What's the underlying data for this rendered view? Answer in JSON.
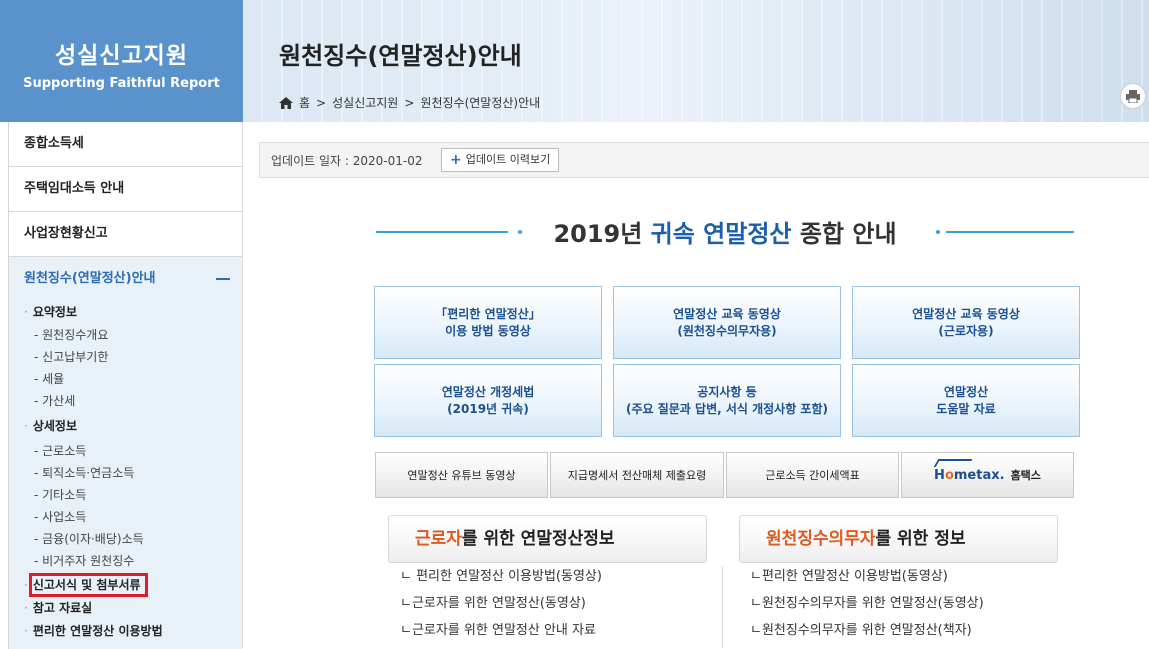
{
  "logo": {
    "title": "성실신고지원",
    "subtitle": "Supporting Faithful Report"
  },
  "header": {
    "page_title": "원천징수(연말정산)안내",
    "breadcrumb": [
      "홈",
      "성실신고지원",
      "원천징수(연말정산)안내"
    ],
    "separator": ">"
  },
  "sidebar": {
    "items": [
      "종합소득세",
      "주택임대소득 안내",
      "사업장현황신고"
    ],
    "active": {
      "label": "원천징수(연말정산)안내",
      "groups": [
        {
          "label": "요약정보",
          "children": [
            "- 원천징수개요",
            "- 신고납부기한",
            "- 세율",
            "- 가산세"
          ]
        },
        {
          "label": "상세정보",
          "children": [
            "- 근로소득",
            "- 퇴직소득·연금소득",
            "- 기타소득",
            "- 사업소득",
            "- 금융(이자·배당)소득",
            "- 비거주자 원천징수"
          ]
        },
        {
          "label": "신고서식 및 첨부서류",
          "children": []
        },
        {
          "label": "참고 자료실",
          "children": []
        },
        {
          "label": "편리한 연말정산 이용방법",
          "children": []
        }
      ]
    }
  },
  "update": {
    "label": "업데이트 일자 : 2020-01-02",
    "history_button": "업데이트 이력보기"
  },
  "main_title": {
    "prefix": "2019년 ",
    "accent": "귀속 연말정산",
    "suffix": " 종합 안내"
  },
  "big_buttons": [
    [
      "「편리한 연말정산」",
      "이용 방법 동영상"
    ],
    [
      "연말정산 교육 동영상",
      "(원천징수의무자용)"
    ],
    [
      "연말정산 교육 동영상",
      "(근로자용)"
    ],
    [
      "연말정산 개정세법",
      "(2019년 귀속)"
    ],
    [
      "공지사항 등",
      "(주요 질문과 답변, 서식 개정사항 포함)"
    ],
    [
      "연말정산",
      "도움말 자료"
    ]
  ],
  "gray_buttons": [
    "연말정산 유튜브 동영상",
    "지급명세서 전산매체 제출요령",
    "근로소득 간이세액표",
    "홈택스"
  ],
  "hometax_logo": {
    "left": "H",
    "o": "o",
    "right": "metax."
  },
  "worker_box": {
    "title_accent": "근로자",
    "title_rest": "를 위한 연말정산정보",
    "links": [
      "ㄴ 편리한 연말정산 이용방법(동영상)",
      "ㄴ근로자를 위한 연말정산(동영상)",
      "ㄴ근로자를 위한 연말정산 안내 자료"
    ]
  },
  "withholder_box": {
    "title_accent": "원천징수의무자",
    "title_rest": "를 위한 정보",
    "links": [
      "ㄴ편리한 연말정산 이용방법(동영상)",
      "ㄴ원천징수의무자를 위한 연말정산(동영상)",
      "ㄴ원천징수의무자를 위한 연말정산(책자)"
    ]
  },
  "colors": {
    "logo_bg": "#5a93cc",
    "accent_blue": "#1b5eab",
    "accent_orange": "#e0581b",
    "highlight_red": "#e01c2a"
  }
}
